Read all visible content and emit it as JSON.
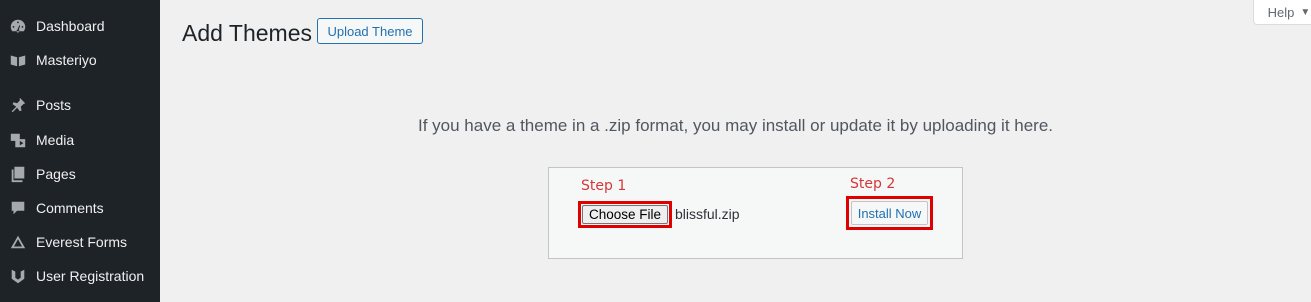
{
  "sidebar": {
    "items": [
      {
        "label": "Dashboard",
        "icon": "dashboard-icon"
      },
      {
        "label": "Masteriyo",
        "icon": "book-icon"
      },
      {
        "label": "Posts",
        "icon": "pushpin-icon"
      },
      {
        "label": "Media",
        "icon": "media-icon"
      },
      {
        "label": "Pages",
        "icon": "pages-icon"
      },
      {
        "label": "Comments",
        "icon": "comment-icon"
      },
      {
        "label": "Everest Forms",
        "icon": "everest-forms-icon"
      },
      {
        "label": "User Registration",
        "icon": "user-registration-icon"
      }
    ]
  },
  "header": {
    "title": "Add Themes",
    "upload_button": "Upload Theme",
    "help_label": "Help"
  },
  "upload": {
    "instructions": "If you have a theme in a .zip format, you may install or update it by uploading it here.",
    "step1_label": "Step 1",
    "step2_label": "Step 2",
    "choose_file_label": "Choose File",
    "file_name": "blissful.zip",
    "install_label": "Install Now"
  },
  "colors": {
    "sidebar_bg": "#1d2327",
    "accent": "#2271b1",
    "annotation_red": "#e00000"
  }
}
